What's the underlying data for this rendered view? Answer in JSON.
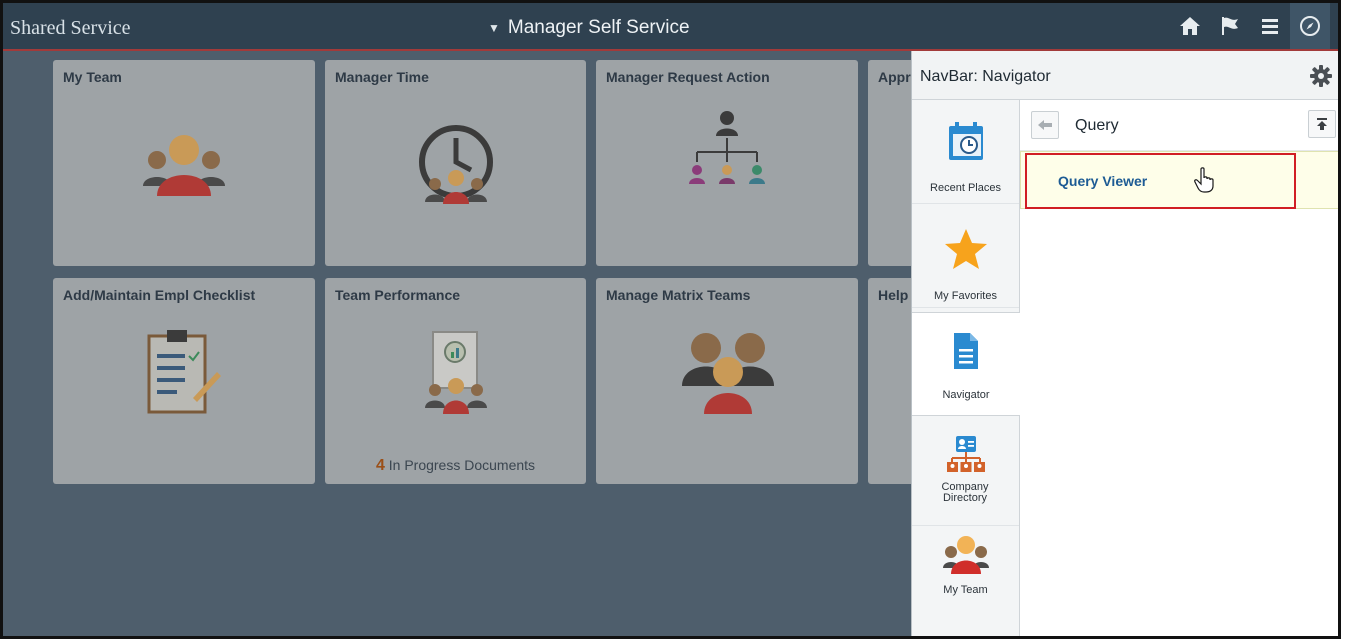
{
  "header": {
    "brand": "Shared Service",
    "caret": "▼",
    "homepage_title": "Manager Self Service",
    "icons": [
      "home-icon",
      "flag-icon",
      "menu-icon",
      "compass-icon"
    ]
  },
  "tiles": [
    {
      "title": "My Team",
      "icon": "team-icon",
      "footer": ""
    },
    {
      "title": "Manager Time",
      "icon": "clock-team-icon",
      "footer": ""
    },
    {
      "title": "Manager Request Action",
      "icon": "org-chart-icon",
      "footer": ""
    },
    {
      "title": "Appr",
      "icon": "",
      "footer": ""
    },
    {
      "title": "Add/Maintain Empl Checklist",
      "icon": "checklist-icon",
      "footer": ""
    },
    {
      "title": "Team Performance",
      "icon": "performance-icon",
      "footer_count": "4",
      "footer_text": " In Progress Documents"
    },
    {
      "title": "Manage Matrix Teams",
      "icon": "matrix-team-icon",
      "footer": ""
    },
    {
      "title": "Help",
      "icon": "",
      "footer": ""
    }
  ],
  "navbar": {
    "title": "NavBar: Navigator",
    "settings_icon": "gear-icon",
    "side_items": [
      {
        "label": "Recent Places",
        "icon": "calendar-clock-icon"
      },
      {
        "label": "My Favorites",
        "icon": "star-icon"
      },
      {
        "label": "Navigator",
        "icon": "document-icon"
      },
      {
        "label": "Company Directory",
        "icon": "directory-icon"
      },
      {
        "label": "My Team",
        "icon": "team-icon"
      }
    ],
    "folder": {
      "title": "Query",
      "back_icon": "back-arrow-icon",
      "top_icon": "back-to-top-icon",
      "items": [
        {
          "label": "Query Viewer"
        }
      ]
    }
  },
  "colors": {
    "background": "#4e5e6c",
    "topbar": "#2f4150",
    "highlight_border": "#d11e24",
    "link": "#1d5b94",
    "star": "#f7a31c"
  }
}
